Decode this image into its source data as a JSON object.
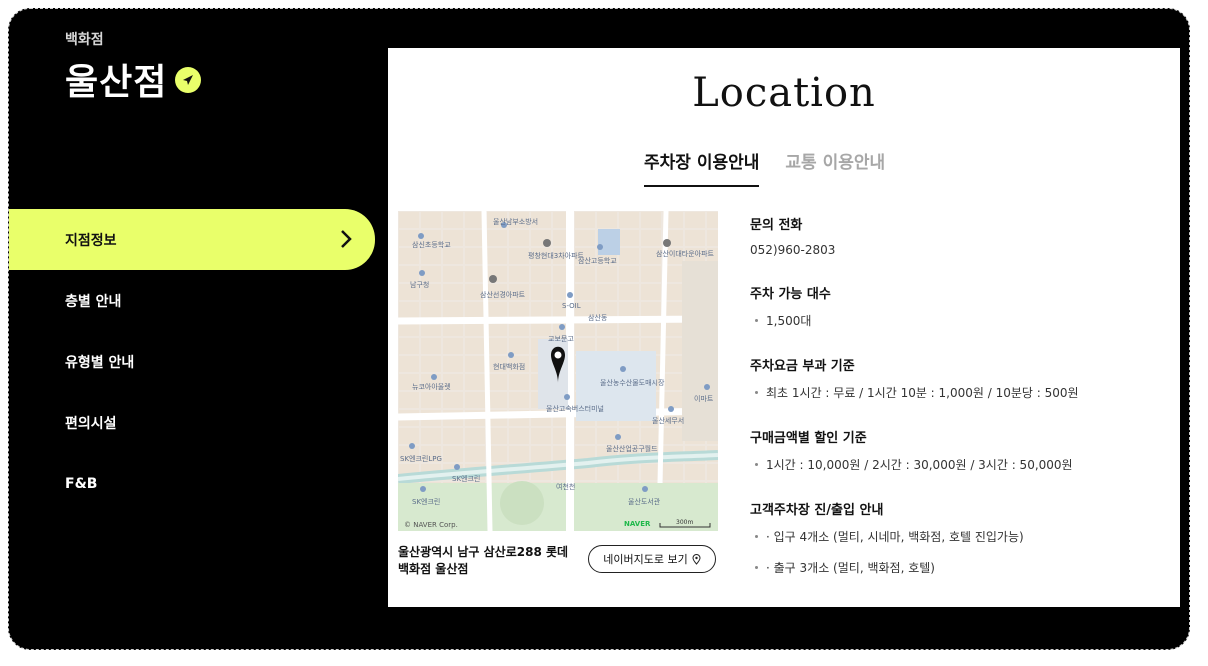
{
  "brand": {
    "subtitle": "백화점",
    "title": "울산점"
  },
  "nav": {
    "items": [
      {
        "label": "지점정보",
        "active": true
      },
      {
        "label": "층별 안내"
      },
      {
        "label": "유형별 안내"
      },
      {
        "label": "편의시설"
      },
      {
        "label": "F&B"
      }
    ]
  },
  "main": {
    "title": "Location",
    "tabs": [
      {
        "label": "주차장 이용안내",
        "active": true
      },
      {
        "label": "교통 이용안내"
      }
    ],
    "map": {
      "address": "울산광역시 남구 삼산로288 롯데백화점 울산점",
      "button_label": "네이버지도로 보기",
      "credit": "© NAVER Corp.",
      "provider": "NAVER",
      "scale": "300m",
      "labels": [
        "삼신초등학교",
        "울산남부소방서",
        "평창현대3차아파트",
        "삼산고등학교",
        "삼산이대타운아파트",
        "남구청",
        "삼산선경아파트",
        "S-OIL",
        "삼산동",
        "교보문고",
        "현대백화점",
        "뉴코아아울렛",
        "울산고속버스터미널",
        "울산농수산물도매시장",
        "이마트",
        "울산세무서",
        "울산산업공구월드",
        "SK엔크린LPG",
        "SK엔크린",
        "SK엔크린",
        "여천천",
        "울산도서관"
      ]
    },
    "info": {
      "contact_heading": "문의 전화",
      "contact_value": "052)960-2803",
      "capacity_heading": "주차 가능 대수",
      "capacity_value": "1,500대",
      "fee_heading": "주차요금 부과 기준",
      "fee_value": "최초 1시간 : 무료 / 1시간 10분 : 1,000원 / 10분당 : 500원",
      "discount_heading": "구매금액별 할인 기준",
      "discount_value": "1시간 : 10,000원 / 2시간 : 30,000원 / 3시간 : 50,000원",
      "gate_heading": "고객주차장 진/출입 안내",
      "gate_items": [
        "· 입구 4개소 (멀티, 시네마, 백화점, 호텔 진입가능)",
        "· 출구 3개소 (멀티, 백화점, 호텔)"
      ]
    }
  },
  "colors": {
    "accent": "#e9ff6a",
    "background": "#000000",
    "panel": "#ffffff"
  }
}
